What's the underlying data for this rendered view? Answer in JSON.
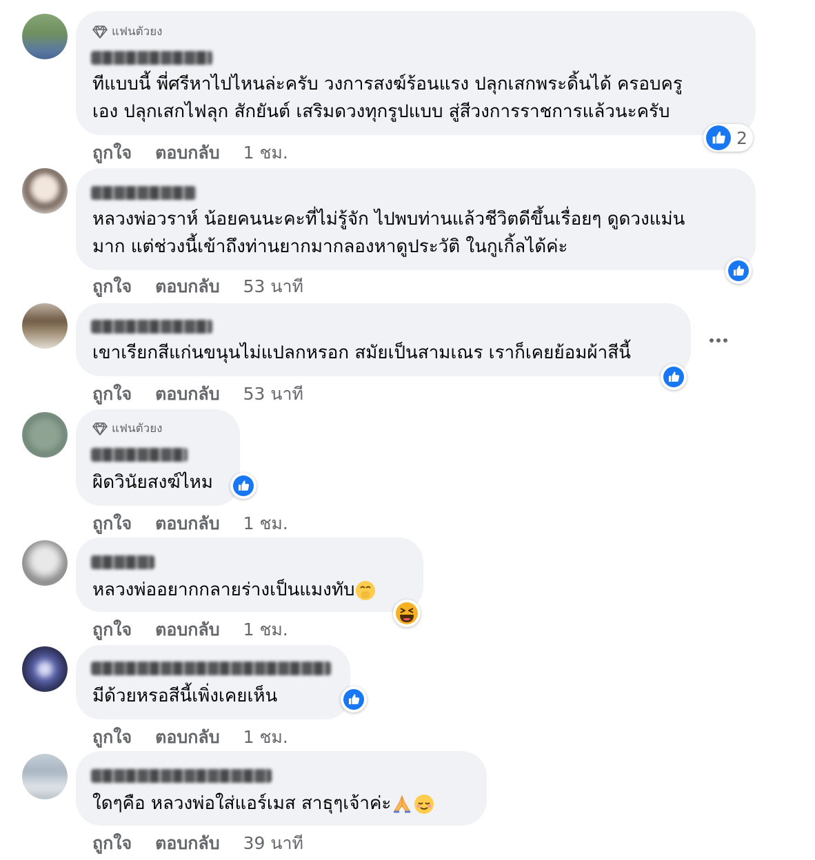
{
  "badge_label": "แฟนตัวยง",
  "colors": {
    "like_blue": "#1877f2",
    "bubble_bg": "#f0f2f5",
    "meta_gray": "#65676b"
  },
  "comments": [
    {
      "text_lines": [
        "ทีแบบนี้ พี่ศรีหาไปไหนล่ะครับ วงการสงฆ์ร้อนแรง ปลุกเสกพระดิ้นได้ ครอบครู",
        "เอง ปลุกเสกไฟลุก สักยันต์ เสริมดวงทุกรูปแบบ สู่สีวงการราชการแล้วนะครับ"
      ],
      "like": "ถูกใจ",
      "reply": "ตอบกลับ",
      "time": "1 ชม.",
      "reaction_count": "2",
      "reaction_icon": "like-icon"
    },
    {
      "text_lines": [
        "หลวงพ่อวราห์ น้อยคนนะคะที่ไม่รู้จัก ไปพบท่านแล้วชีวิตดีขึ้นเรื่อยๆ ดูดวงแม่น",
        "มาก แต่ช่วงนี้เข้าถึงท่านยากมากลองหาดูประวัติ ในกูเกิ้ลได้ค่ะ"
      ],
      "like": "ถูกใจ",
      "reply": "ตอบกลับ",
      "time": "53 นาที",
      "reaction_icon": "like-icon"
    },
    {
      "text_lines": [
        "เขาเรียกสีแก่นขนุนไม่แปลกหรอก สมัยเป็นสามเณร เราก็เคยย้อมผ้าสีนี้"
      ],
      "like": "ถูกใจ",
      "reply": "ตอบกลับ",
      "time": "53 นาที",
      "reaction_icon": "like-icon"
    },
    {
      "text_lines": [
        "ผิดวินัยสงฆ์ไหม"
      ],
      "like": "ถูกใจ",
      "reply": "ตอบกลับ",
      "time": "1 ชม.",
      "reaction_icon": "like-icon"
    },
    {
      "text_lines": [
        "หลวงพ่ออยากกลายร่างเป็นแมงทับ"
      ],
      "like": "ถูกใจ",
      "reply": "ตอบกลับ",
      "time": "1 ชม.",
      "reaction_icon": "haha-icon"
    },
    {
      "text_lines": [
        "มีด้วยหรอสีนี้เพิ่งเคยเห็น"
      ],
      "like": "ถูกใจ",
      "reply": "ตอบกลับ",
      "time": "1 ชม.",
      "reaction_icon": "like-icon"
    },
    {
      "text_lines": [
        "ใดๆคือ หลวงพ่อใส่แอร์เมส สาธุๆเจ้าค่ะ"
      ],
      "like": "ถูกใจ",
      "reply": "ตอบกลับ",
      "time": "39 นาที"
    }
  ]
}
